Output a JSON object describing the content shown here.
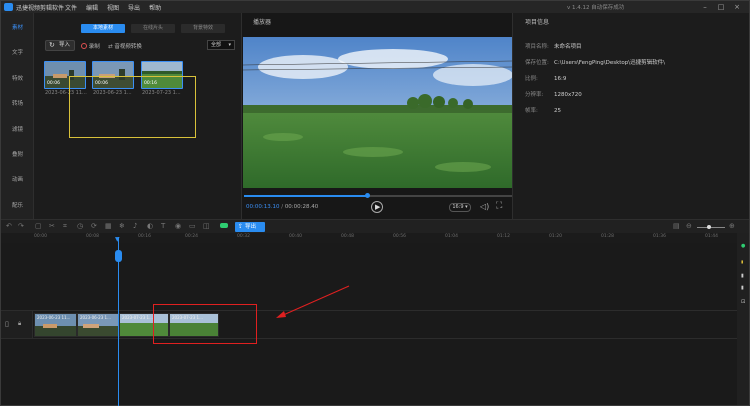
{
  "app": {
    "title": "迅捷视频剪辑软件",
    "menu": [
      "文件",
      "编辑",
      "视图",
      "导出",
      "帮助"
    ],
    "version_status": "v 1.4.12  自动保存成功"
  },
  "sidebar": {
    "items": [
      {
        "label": "素材",
        "active": true
      },
      {
        "label": "文字",
        "active": false
      },
      {
        "label": "特效",
        "active": false
      },
      {
        "label": "转场",
        "active": false
      },
      {
        "label": "滤镜",
        "active": false
      },
      {
        "label": "叠附",
        "active": false
      },
      {
        "label": "动画",
        "active": false
      },
      {
        "label": "配乐",
        "active": false
      }
    ]
  },
  "media": {
    "tabs": [
      {
        "label": "本地素材",
        "active": true
      },
      {
        "label": "在线片头",
        "active": false
      },
      {
        "label": "背景特效",
        "active": false
      }
    ],
    "import_label": "导入",
    "record_label": "录制",
    "convert_label": "音视频转换",
    "filter_value": "全部",
    "thumbnails": [
      {
        "duration": "00:06",
        "date": "2023-06-23 11..."
      },
      {
        "duration": "00:06",
        "date": "2023-06-23 1..."
      },
      {
        "duration": "00:16",
        "date": "2023-07-23 1..."
      }
    ]
  },
  "player": {
    "title": "播放器",
    "current_time": "00:00:13.10",
    "total_time": "00:00:28.40",
    "ratio": "16:9",
    "progress": 0.46
  },
  "project_info": {
    "title": "项目信息",
    "rows": [
      {
        "key": "项目名称:",
        "value": "未命名项目"
      },
      {
        "key": "保存位置:",
        "value": "C:\\Users\\FengPing\\Desktop\\迅捷剪辑软件\\"
      },
      {
        "key": "比例:",
        "value": "16:9"
      },
      {
        "key": "分辨率:",
        "value": "1280x720"
      },
      {
        "key": "帧率:",
        "value": "25"
      }
    ]
  },
  "timeline": {
    "export_label": "导出",
    "ruler_ticks": [
      "00:00",
      "00:08",
      "00:16",
      "00:24",
      "00:32",
      "00:40",
      "00:48",
      "00:56",
      "01:04",
      "01:12",
      "01:20",
      "01:28",
      "01:36",
      "01:44"
    ],
    "clips": [
      {
        "label": "2023-06-23 11..."
      },
      {
        "label": "2023-06-23 1..."
      },
      {
        "label": "2023-07-23 1..."
      },
      {
        "label": "2023-07-23 1..."
      }
    ],
    "playhead_time": "00:13"
  },
  "colors": {
    "accent": "#2a8cf0",
    "highlight_box": "#e02020",
    "selection_box": "#d8c13a"
  }
}
